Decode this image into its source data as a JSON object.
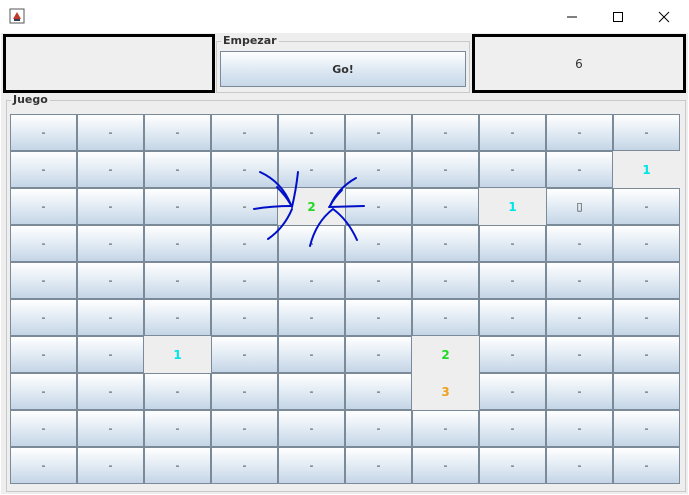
{
  "window": {
    "minimize_glyph": "—",
    "maximize_glyph": "☐",
    "close_glyph": "✕"
  },
  "left_panel": {
    "text": ""
  },
  "start_group": {
    "title": "Empezar",
    "go_label": "Go!"
  },
  "right_panel": {
    "value": "6"
  },
  "game_group": {
    "title": "Juego"
  },
  "colors": {
    "one": "#00e5e5",
    "two": "#22d822",
    "three": "#f0a020",
    "scribble": "#0010c8"
  },
  "grid": {
    "rows": [
      [
        "-",
        "-",
        "-",
        "-",
        "-",
        "-",
        "-",
        "-",
        "-",
        "-"
      ],
      [
        "-",
        "-",
        "-",
        "-",
        "-",
        "-",
        "-",
        "-",
        "-",
        "1"
      ],
      [
        "-",
        "-",
        "-",
        "-",
        "2",
        "-",
        "-",
        "1",
        "▯",
        "-"
      ],
      [
        "-",
        "-",
        "-",
        "-",
        "-",
        "-",
        "-",
        "-",
        "-",
        "-"
      ],
      [
        "-",
        "-",
        "-",
        "-",
        "-",
        "-",
        "-",
        "-",
        "-",
        "-"
      ],
      [
        "-",
        "-",
        "-",
        "-",
        "-",
        "-",
        "-",
        "-",
        "-",
        "-"
      ],
      [
        "-",
        "-",
        "1",
        "-",
        "-",
        "-",
        "2",
        "-",
        "-",
        "-"
      ],
      [
        "-",
        "-",
        "-",
        "-",
        "-",
        "-",
        "3",
        "-",
        "-",
        "-"
      ],
      [
        "-",
        "-",
        "-",
        "-",
        "-",
        "-",
        "-",
        "-",
        "-",
        "-"
      ],
      [
        "-",
        "-",
        "-",
        "-",
        "-",
        "-",
        "-",
        "-",
        "-",
        "-"
      ]
    ],
    "revealed": [
      [
        1,
        9
      ],
      [
        2,
        4
      ],
      [
        2,
        7
      ],
      [
        6,
        2
      ],
      [
        6,
        6
      ],
      [
        7,
        6
      ]
    ]
  }
}
